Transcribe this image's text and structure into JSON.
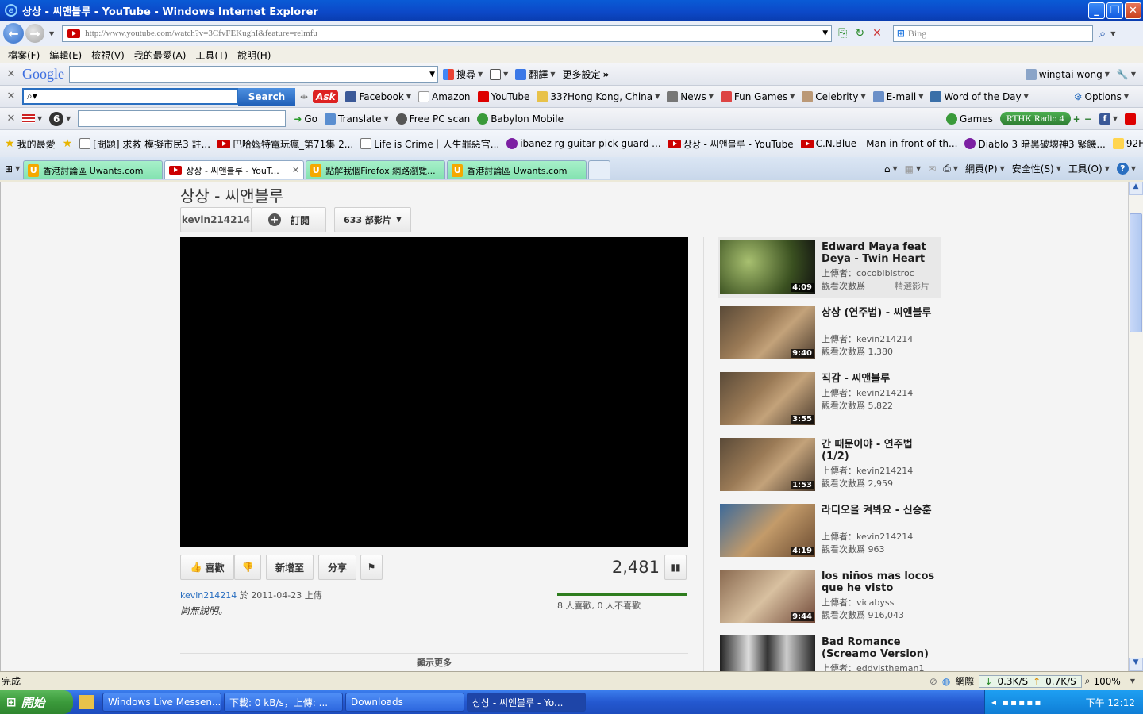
{
  "window": {
    "title": "상상 - 씨앤블루 - YouTube - Windows Internet Explorer"
  },
  "address": {
    "url": "http://www.youtube.com/watch?v=3CfvFEKughI&feature=relmfu",
    "search_placeholder": "Bing"
  },
  "menu": [
    "檔案(F)",
    "編輯(E)",
    "檢視(V)",
    "我的最愛(A)",
    "工具(T)",
    "說明(H)"
  ],
  "google_bar": {
    "logo": "Google",
    "search": "搜尋",
    "translate": "翻譯",
    "more": "更多設定",
    "user": "wingtai wong"
  },
  "ask_bar": {
    "search_button": "Search",
    "ask": "Ask",
    "links": [
      "Facebook",
      "Amazon",
      "YouTube",
      "33?Hong Kong, China",
      "News",
      "Fun Games",
      "Celebrity",
      "E-mail",
      "Word of the Day"
    ],
    "options": "Options"
  },
  "babylon_bar": {
    "go": "Go",
    "translate": "Translate",
    "scan": "Free PC scan",
    "mobile": "Babylon Mobile",
    "games": "Games",
    "radio": "RTHK Radio 4"
  },
  "favorites": {
    "label": "我的最愛",
    "items": [
      "[問題] 求救 模擬市民3 註...",
      "巴哈姆特電玩瘋_第71集 2...",
      "Life is Crime｜人生罪惡官...",
      "ibanez rg guitar pick guard ...",
      "상상 - 씨앤블루 - YouTube",
      "C.N.Blue - Man in front of th...",
      "Diablo 3 暗黑破壞神3 緊饑...",
      "92FLV"
    ]
  },
  "tabs": [
    "香港討論區 Uwants.com",
    "상상 - 씨앤블루 - YouT...",
    "點解我個Firefox 網路瀏覽...",
    "香港討論區 Uwants.com"
  ],
  "cmdbar": {
    "page": "網頁(P)",
    "safety": "安全性(S)",
    "tools": "工具(O)"
  },
  "video": {
    "title": "상상 - 씨앤블루",
    "channel": "kevin214214",
    "subscribe": "訂閱",
    "video_count": "633 部影片",
    "like": "喜歡",
    "add_to": "新增至",
    "share": "分享",
    "views": "2,481",
    "uploader": "kevin214214",
    "upload_info": "於 2011-04-23 上傳",
    "likes_text": "8 人喜歡, 0 人不喜歡",
    "description": "尚無說明。",
    "show_more": "顯示更多"
  },
  "related": [
    {
      "title": "Edward Maya feat Deya - Twin Heart",
      "uploader": "上傳者：cocobibistroc",
      "views": "觀看次數爲",
      "extra": "精選影片",
      "duration": "4:09"
    },
    {
      "title": "상상 (연주법) - 씨앤블루",
      "uploader": "上傳者：kevin214214",
      "views": "觀看次數爲 1,380",
      "duration": "9:40"
    },
    {
      "title": "직감 - 씨앤블루",
      "uploader": "上傳者：kevin214214",
      "views": "觀看次數爲 5,822",
      "duration": "3:55"
    },
    {
      "title": "간 때문이야 - 연주법 (1/2)",
      "uploader": "上傳者：kevin214214",
      "views": "觀看次數爲 2,959",
      "duration": "1:53"
    },
    {
      "title": "라디오을 켜봐요 - 신승훈",
      "uploader": "上傳者：kevin214214",
      "views": "觀看次數爲 963",
      "duration": "4:19"
    },
    {
      "title": "los niños mas locos que he visto",
      "uploader": "上傳者：vicabyss",
      "views": "觀看次數爲 916,043",
      "duration": "9:44"
    },
    {
      "title": "Bad Romance (Screamo Version)",
      "uploader": "上傳者：eddyistheman1",
      "views": "",
      "duration": ""
    }
  ],
  "status": {
    "text": "完成",
    "network": "網際",
    "down": "0.3K/S",
    "up": "0.7K/S",
    "zoom": "100%"
  },
  "taskbar": {
    "start": "開始",
    "tasks": [
      "Windows Live Messen...",
      "下載: 0 kB/s，上傳: ...",
      "Downloads",
      "상상 - 씨앤블루 - Yo..."
    ],
    "clock": "下午 12:12"
  },
  "colors": {
    "titlebar": "#0a5bd6",
    "like_bar": "#2e7d1e",
    "link": "#2a6fc0"
  }
}
